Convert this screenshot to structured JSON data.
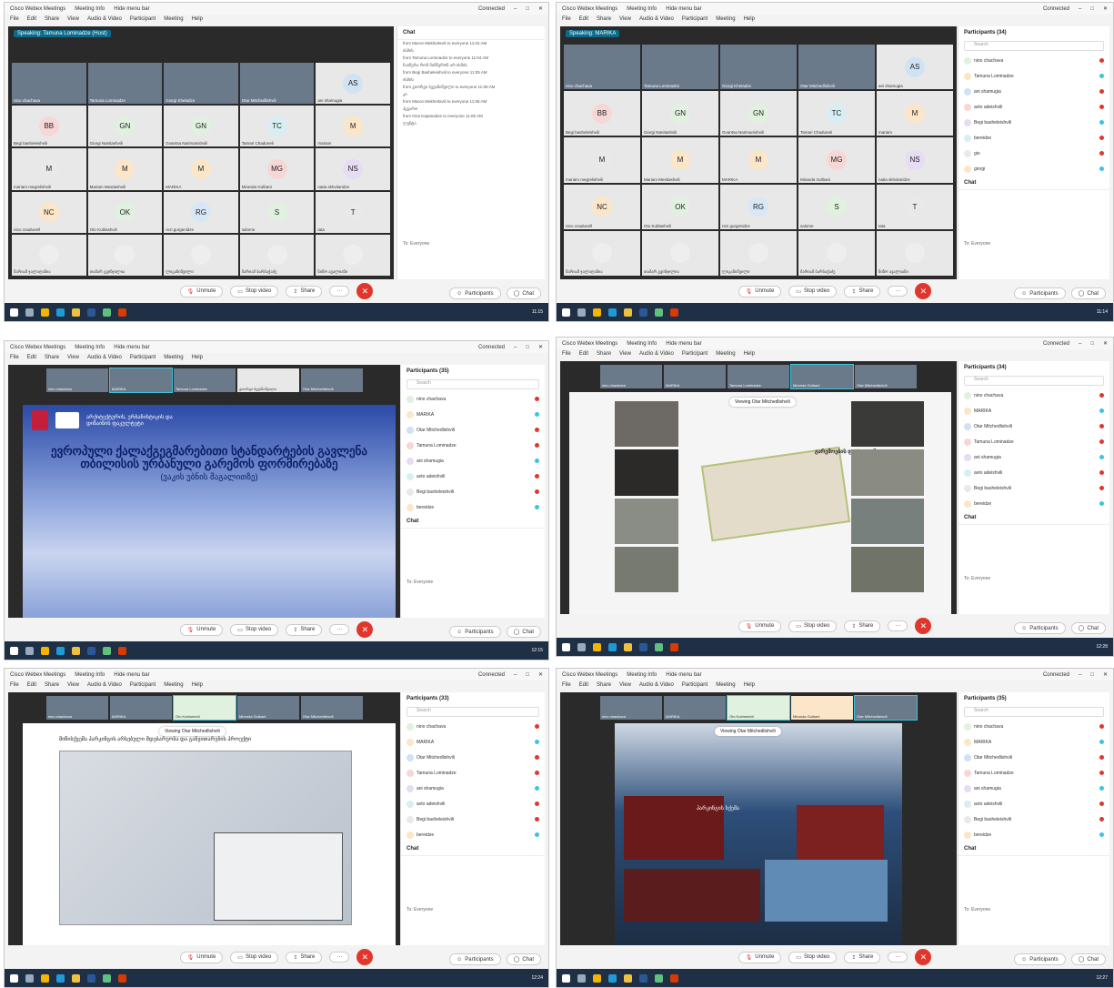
{
  "app": {
    "title_left": "Cisco Webex Meetings",
    "meeting_info": "Meeting Info",
    "hide_menu": "Hide menu bar",
    "connected": "Connected",
    "menu": [
      "File",
      "Edit",
      "Share",
      "View",
      "Audio & Video",
      "Participant",
      "Meeting",
      "Help"
    ]
  },
  "controls": {
    "unmute": "Unmute",
    "stop_video": "Stop video",
    "share": "Share",
    "participants": "Participants",
    "chat": "Chat",
    "more": "···"
  },
  "panels": [
    {
      "speaking": "Speaking: Tamuna Lominadze (Host)",
      "chat_title": "Chat",
      "chat_messages": [
        "from Maron Mekheitsvili to everyone 11:04 AM",
        "ისმის",
        "from Tamuna Lominadze to everyone 11:04 AM",
        "ჩაიწერა რომ მიმწერონ არ ისმის",
        "from Begi Basheleishvili to everyone 11:05 AM",
        "ისმის",
        "from გიორგი ბეჟანიშვილი to everyone 11:05 AM",
        "კი",
        "from Maron Mekheitsvili to everyone 11:06 AM",
        "ჰყვარო",
        "from Irina Kapanadze to everyone 11:06 AM",
        "ლენტი"
      ],
      "to_label": "To: Everyone",
      "time": "11:15"
    },
    {
      "participants_title": "Participants (34)",
      "participants": [
        "nino chachava",
        "Tamuna Lominadze",
        "ani shamugia",
        "avto adeishvili",
        "Begi basheleishvili",
        "bereidze",
        "gio",
        "giorgi"
      ],
      "chat_title": "Chat",
      "to_label": "To: Everyone",
      "time": "11:14"
    },
    {
      "participants_title": "Participants (35)",
      "participants": [
        "nino chachava",
        "MARIKA",
        "Otar Mitchedlishvili",
        "Tamuna Lominadze",
        "ani shamugia",
        "avto adeishvili",
        "Begi basheleishvili",
        "bereidze"
      ],
      "slide_org": "არქიტექტურის, ურბანისტიკის და დიზაინის ფაკულტეტი",
      "slide_title": "ევროპული ქალაქგეგმარებითი სტანდარტების გავლენა თბილისის ურბანული გარემოს ფორმირებაზე",
      "slide_subtitle": "(ვაკის უბნის მაგალითზე)",
      "chat_title": "Chat",
      "to_label": "To: Everyone",
      "time": "12:15"
    },
    {
      "participants_title": "Participants (34)",
      "participants": [
        "nino chachava",
        "MARIKA",
        "Otar Mitchedlishvili",
        "Tamuna Lominadze",
        "ani shamugia",
        "avto adeishvili",
        "Begi basheleishvili",
        "bereidze"
      ],
      "viewing": "Viewing Otar Mitchedlishvili",
      "slide_caption": "გარემოების ფოტოფიქსაცია",
      "chat_title": "Chat",
      "to_label": "To: Everyone",
      "time": "12:28"
    },
    {
      "participants_title": "Participants (33)",
      "participants": [
        "nino chachava",
        "MARIKA",
        "Otar Mitchedlishvili",
        "Tamuna Lominadze",
        "ani shamugia",
        "avto adeishvili",
        "Begi basheleishvili",
        "bereidze"
      ],
      "viewing": "Viewing Otar Mitchedlishvili",
      "slide_title": "მიწისქვეშა პარკინგის არსებული მდებარეობა და განვითარების პროექტი",
      "chat_title": "Chat",
      "to_label": "To: Everyone",
      "time": "12:24"
    },
    {
      "participants_title": "Participants (35)",
      "participants": [
        "nino chachava",
        "MARIKA",
        "Otar Mitchedlishvili",
        "Tamuna Lominadze",
        "ani shamugia",
        "avto adeishvili",
        "Begi basheleishvili",
        "bereidze"
      ],
      "viewing": "Viewing Otar Mitchedlishvili",
      "slide_text": "პარკინგის სქემა",
      "chat_title": "Chat",
      "to_label": "To: Everyone",
      "time": "12:27"
    }
  ],
  "grid_tiles": [
    {
      "i": "",
      "n": "nino chachava",
      "c": "#e8e8e8",
      "v": true
    },
    {
      "i": "",
      "n": "Tamuna Lominadze",
      "c": "#e8e8e8",
      "v": true
    },
    {
      "i": "",
      "n": "Giorgi Kheladze",
      "c": "#e8e8e8",
      "v": true
    },
    {
      "i": "",
      "n": "Otar Mitchedlishvili",
      "c": "#e8e8e8",
      "v": true
    },
    {
      "i": "AS",
      "n": "ani shamugia",
      "c": "#cfe3f5",
      "v": false
    },
    {
      "i": "BB",
      "n": "Begi basheleishvili",
      "c": "#f7d6d6",
      "v": false
    },
    {
      "i": "GN",
      "n": "Giorgi Nanitashvili",
      "c": "#e0f1df",
      "v": false
    },
    {
      "i": "GN",
      "n": "Gvantsa Narimanishvili",
      "c": "#e0f1df",
      "v": false
    },
    {
      "i": "TC",
      "n": "Tamari Chaduneli",
      "c": "#d7eef2",
      "v": false
    },
    {
      "i": "M",
      "n": "mariam",
      "c": "#fbe6c9",
      "v": false
    },
    {
      "i": "M",
      "n": "mariam megrelishvili",
      "c": "#e9e9e9",
      "v": false
    },
    {
      "i": "M",
      "n": "Mariam Mestiashvili",
      "c": "#fbe6c9",
      "v": false
    },
    {
      "i": "M",
      "n": "MARIKA",
      "c": "#fbe6c9",
      "v": false
    },
    {
      "i": "MG",
      "n": "Miranda Gulbani",
      "c": "#f7d6d6",
      "v": false
    },
    {
      "i": "NS",
      "n": "natia skhvitaridze",
      "c": "#e6dcf3",
      "v": false
    },
    {
      "i": "NC",
      "n": "nino cnadunell",
      "c": "#fbe6c9",
      "v": false
    },
    {
      "i": "OK",
      "n": "Oto Kublashvili",
      "c": "#e0f1df",
      "v": false
    },
    {
      "i": "RG",
      "n": "rezi gurgenidze",
      "c": "#d7e7f5",
      "v": false
    },
    {
      "i": "S",
      "n": "salome",
      "c": "#e0f1df",
      "v": false
    },
    {
      "i": "T",
      "n": "tata",
      "c": "#e9e9e9",
      "v": false
    },
    {
      "i": "",
      "n": "მარიამ ჯალაღანია",
      "c": "#eeeeee",
      "v": false
    },
    {
      "i": "",
      "n": "თამარ გვინჯილია",
      "c": "#eeeeee",
      "v": false
    },
    {
      "i": "",
      "n": "ლიკანიშვილი",
      "c": "#eeeeee",
      "v": false
    },
    {
      "i": "",
      "n": "მარიამ ბარბაქაძე",
      "c": "#eeeeee",
      "v": false
    },
    {
      "i": "",
      "n": "ნინო ავალიანი",
      "c": "#eeeeee",
      "v": false
    }
  ]
}
